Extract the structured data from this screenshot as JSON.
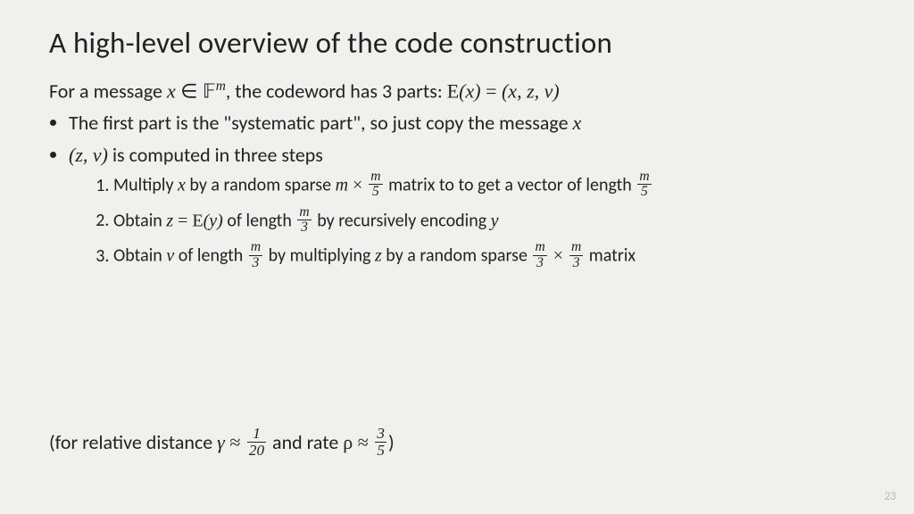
{
  "title": "A high-level overview of the code construction",
  "intro": {
    "pre": "For a message ",
    "x": "x",
    "in": " ∈ ",
    "F": "𝔽",
    "m_sup": "m",
    "mid": ", the codeword has 3 parts: ",
    "E": "E",
    "paren_x": "(x)",
    "eq": " = ",
    "tuple": "(x, z, v)"
  },
  "bullet1": {
    "pre": "The first part is the \"systematic part\", so just copy the message ",
    "x": "x"
  },
  "bullet2": {
    "tuple": "(z, v)",
    "post": " is computed in three steps"
  },
  "step1": {
    "pre": "Multiply ",
    "x": "x",
    "mid1": " by a random sparse ",
    "m": "m",
    "times": " × ",
    "frac1_num": "m",
    "frac1_den": "5",
    "mid2": " matrix to to get a vector of length ",
    "frac2_num": "m",
    "frac2_den": "5"
  },
  "step2": {
    "pre": "Obtain ",
    "z": "z",
    "eq": " = ",
    "E": "E",
    "y": "(y)",
    "mid": " of length ",
    "frac_num": "m",
    "frac_den": "3",
    "post": " by recursively encoding ",
    "yvar": "y"
  },
  "step3": {
    "pre": "Obtain ",
    "v": "v",
    "mid1": "  of length ",
    "frac1_num": "m",
    "frac1_den": "3",
    "mid2": " by multiplying ",
    "z": "z",
    "mid3": " by a random sparse ",
    "frac2_num": "m",
    "frac2_den": "3",
    "times": " × ",
    "frac3_num": "m",
    "frac3_den": "3",
    "post": " matrix"
  },
  "footnote": {
    "pre": "(for relative distance ",
    "gamma": "γ",
    "approx1": " ≈ ",
    "frac1_num": "1",
    "frac1_den": "20",
    "mid": " and rate ",
    "rho": "ρ",
    "approx2": " ≈ ",
    "frac2_num": "3",
    "frac2_den": "5",
    "post": ")"
  },
  "page_number": "23"
}
